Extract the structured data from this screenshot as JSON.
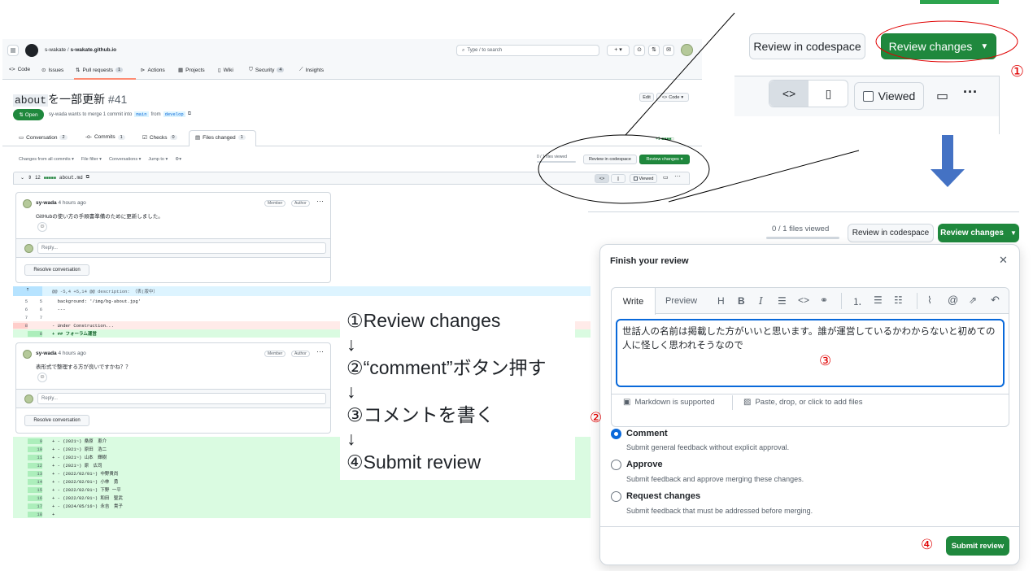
{
  "left_screen": {
    "repo_owner": "s-wakate",
    "repo_name": "s-wakate.github.io",
    "search_placeholder": "Type / to search",
    "nav": [
      {
        "label": "Code",
        "count": ""
      },
      {
        "label": "Issues",
        "count": ""
      },
      {
        "label": "Pull requests",
        "count": "1"
      },
      {
        "label": "Actions",
        "count": ""
      },
      {
        "label": "Projects",
        "count": ""
      },
      {
        "label": "Wiki",
        "count": ""
      },
      {
        "label": "Security",
        "count": "4"
      },
      {
        "label": "Insights",
        "count": ""
      }
    ],
    "pr_title_code": "about",
    "pr_title_text": "を一部更新",
    "pr_number": "#41",
    "edit_label": "Edit",
    "code_label": "Code",
    "state": "Open",
    "merge_text": "sy-wada wants to merge 1 commit into",
    "base_branch": "main",
    "from_text": "from",
    "head_branch": "develop",
    "tabs": [
      {
        "label": "Conversation",
        "count": "2"
      },
      {
        "label": "Commits",
        "count": "1"
      },
      {
        "label": "Checks",
        "count": "0"
      },
      {
        "label": "Files changed",
        "count": "1"
      }
    ],
    "filters": [
      "Changes from all commits ▾",
      "File filter ▾",
      "Conversations ▾",
      "Jump to ▾"
    ],
    "files_viewed": "0 / 1 files viewed",
    "review_in_codespace": "Review in codespace",
    "review_changes": "Review changes",
    "diff_stat": "+1 ■■■■□",
    "file_count": "12",
    "file_name": "about.md",
    "viewed_label": "Viewed",
    "comment1": {
      "author": "sy-wada",
      "time": "4 hours ago",
      "body": "GitHubの使い方の手順書準備のために更新しました。",
      "badges": [
        "Member",
        "Author"
      ]
    },
    "comment2": {
      "author": "sy-wada",
      "time": "4 hours ago",
      "body": "表形式で整理する方が良いですかね？？",
      "badges": [
        "Member",
        "Author"
      ]
    },
    "reply_placeholder": "Reply...",
    "resolve_label": "Resolve conversation",
    "hunk_header": "@@ -5,4 +5,14 @@ description: （表(版中）",
    "diff_lines_top": [
      {
        "n1": "5",
        "n2": "5",
        "code": "  background: '/img/bg-about.jpg'",
        "type": "ctx"
      },
      {
        "n1": "6",
        "n2": "6",
        "code": "  ---",
        "type": "ctx"
      },
      {
        "n1": "7",
        "n2": "7",
        "code": "",
        "type": "ctx"
      },
      {
        "n1": "8",
        "n2": "",
        "code": "- Under Construction...",
        "type": "del"
      },
      {
        "n1": "",
        "n2": "8",
        "code": "+ ## フォーラム運営",
        "type": "add"
      }
    ],
    "diff_lines_bottom": [
      {
        "n2": "9",
        "code": "+ - (2021~) 桑原　恵介"
      },
      {
        "n2": "10",
        "code": "+ - (2021~) 原田　浩二"
      },
      {
        "n2": "11",
        "code": "+ - (2021~) 山本　輝樹"
      },
      {
        "n2": "12",
        "code": "+ - (2021~) 原　広司"
      },
      {
        "n2": "13",
        "code": "+ - (2022/02/01~) 中野貴尚"
      },
      {
        "n2": "14",
        "code": "+ - (2022/02/01~) 小林　勇"
      },
      {
        "n2": "15",
        "code": "+ - (2022/02/01~) 下野 一平"
      },
      {
        "n2": "16",
        "code": "+ - (2022/02/01~) 和田　聖武"
      },
      {
        "n2": "17",
        "code": "+ - (2024/05/16~) 永吉　貴子"
      },
      {
        "n2": "18",
        "code": "+"
      }
    ]
  },
  "zoom_top": {
    "review_in_codespace": "Review in codespace",
    "review_changes": "Review changes",
    "viewed_label": "Viewed",
    "marker": "①"
  },
  "steps": {
    "lines": [
      "①Review changes",
      "↓",
      "②“comment”ボタン押す",
      "↓",
      "③コメントを書く",
      "↓",
      "④Submit review"
    ]
  },
  "dialog_header": {
    "files_viewed": "0 / 1 files viewed",
    "review_in_codespace": "Review in codespace",
    "review_changes": "Review changes"
  },
  "dialog": {
    "title": "Finish your review",
    "write_tab": "Write",
    "preview_tab": "Preview",
    "comment_text": "世話人の名前は掲載した方がいいと思います。誰が運営しているかわからないと初めての人に怪しく思われそうなので",
    "markdown_label": "Markdown is supported",
    "attach_label": "Paste, drop, or click to add files",
    "options": [
      {
        "title": "Comment",
        "desc": "Submit general feedback without explicit approval.",
        "selected": true
      },
      {
        "title": "Approve",
        "desc": "Submit feedback and approve merging these changes.",
        "selected": false
      },
      {
        "title": "Request changes",
        "desc": "Submit feedback that must be addressed before merging.",
        "selected": false
      }
    ],
    "submit_label": "Submit review",
    "marker2": "②",
    "marker3": "③",
    "marker4": "④"
  },
  "colors": {
    "accent_green": "#1f883d",
    "marker_red": "#e00000",
    "link_blue": "#0969da",
    "arrow_blue": "#4472c4"
  }
}
